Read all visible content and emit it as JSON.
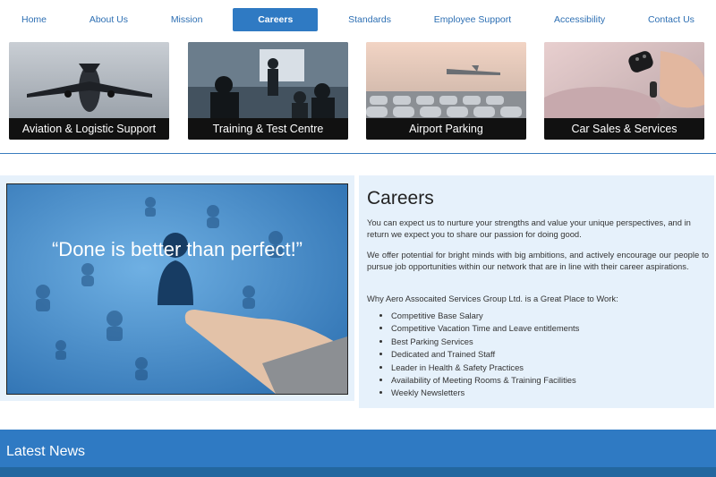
{
  "nav": {
    "items": [
      {
        "label": "Home"
      },
      {
        "label": "About Us"
      },
      {
        "label": "Mission"
      },
      {
        "label": "Careers",
        "active": true
      },
      {
        "label": "Standards"
      },
      {
        "label": "Employee Support"
      },
      {
        "label": "Accessibility"
      },
      {
        "label": "Contact Us"
      }
    ]
  },
  "tiles": [
    {
      "caption": "Aviation & Logistic Support",
      "image": "airplane-photo"
    },
    {
      "caption": "Training & Test Centre",
      "image": "classroom-photo"
    },
    {
      "caption": "Airport Parking",
      "image": "parking-lot-photo"
    },
    {
      "caption": "Car Sales & Services",
      "image": "car-keys-photo"
    }
  ],
  "hero": {
    "quote": "“Done is better than perfect!”",
    "image": "hand-touching-people-network"
  },
  "careers": {
    "title": "Careers",
    "para1": "You can expect us to nurture your strengths and value your unique perspectives, and in return we expect you to share our passion for doing good.",
    "para2": "We offer potential for bright minds with big ambitions, and actively encourage our people to pursue job opportunities within our network that are in line with their career aspirations.",
    "para3": "Why Aero Assocaited Services Group Ltd. is a Great Place to Work:",
    "benefits": [
      "Competitive Base Salary",
      "Competitive Vacation Time and Leave entitlements",
      "Best Parking Services",
      "Dedicated and Trained Staff",
      "Leader in Health & Safety Practices",
      "Availability of Meeting Rooms & Training Facilities",
      "Weekly Newsletters"
    ]
  },
  "news": {
    "title": "Latest News"
  },
  "colors": {
    "accent": "#2f7ac3",
    "panel_bg": "#e6f1fb",
    "nav_text": "#2d6fb3"
  }
}
